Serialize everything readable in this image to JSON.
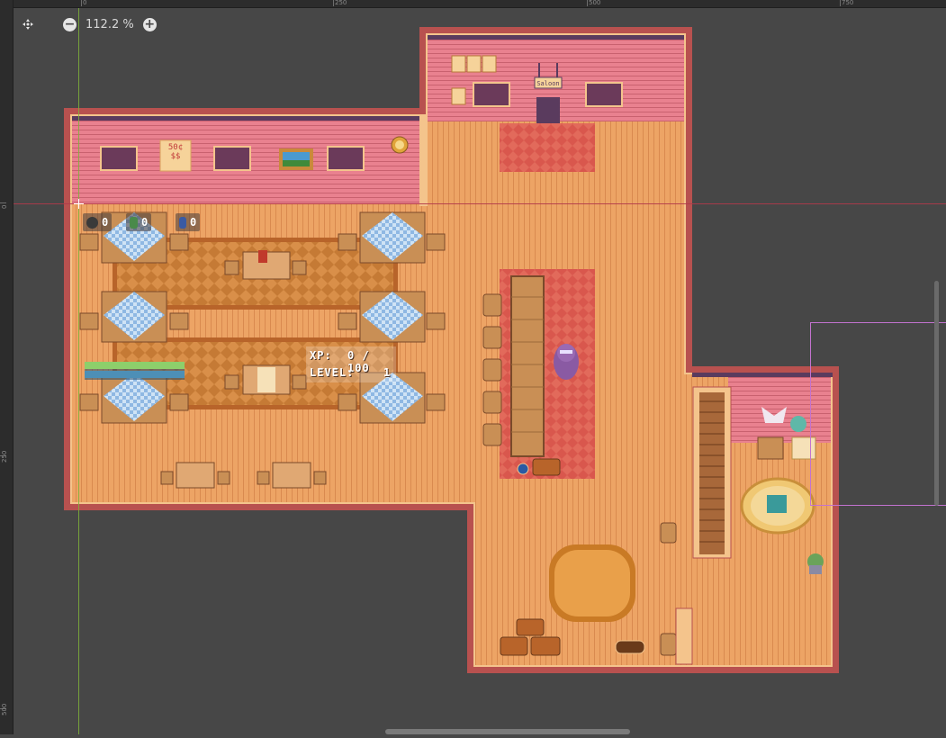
{
  "toolbar": {
    "zoom_level": "112.2 %",
    "center_icon": "center-view-icon",
    "zoom_out_icon": "zoom-out-icon",
    "zoom_in_icon": "zoom-in-icon"
  },
  "rulers": {
    "top_labels": [
      "0",
      "250",
      "500",
      "750"
    ],
    "left_labels": [
      "0",
      "250",
      "500"
    ]
  },
  "hud": {
    "inventory_counts": [
      "0",
      "0",
      "0"
    ],
    "xp_label": "XP:",
    "xp_value": "0 / 100",
    "level_label": "LEVEL:",
    "level_value": "1",
    "health_fraction": 1.0,
    "energy_fraction": 1.0
  },
  "scene": {
    "saloon_sign": "Saloon",
    "price_sign_line1": "50¢",
    "price_sign_line2": "$$"
  },
  "colors": {
    "editor_bg": "#474747",
    "wall_pink": "#e2798a",
    "floor_orange": "#e9a063",
    "outline": "#b8514f",
    "rug_red": "#d9574d",
    "guide_green": "#7fb23a",
    "guide_red": "#b03a4a",
    "selection_purple": "#c373cf"
  }
}
